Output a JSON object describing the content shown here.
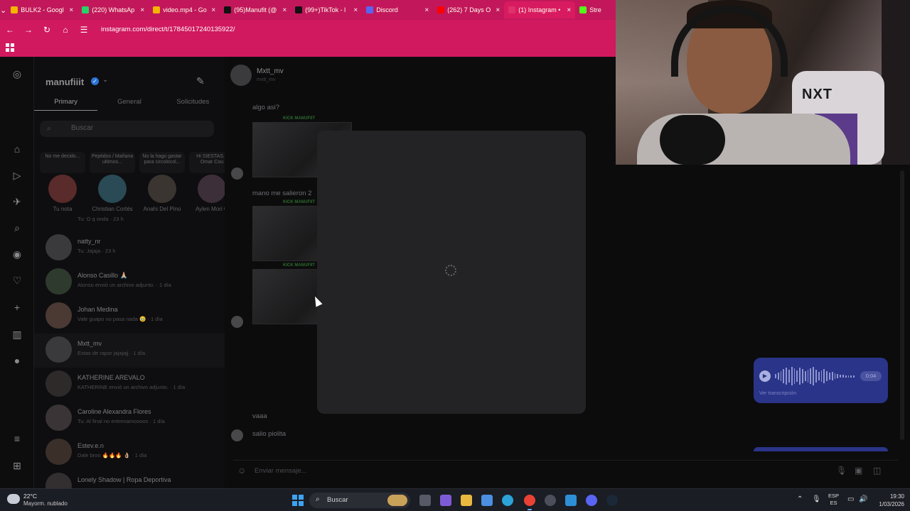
{
  "browser": {
    "tabs": [
      {
        "title": "BULK2 - Googl",
        "color": "#f4b400"
      },
      {
        "title": "(220) WhatsAp",
        "color": "#25d366"
      },
      {
        "title": "video.mp4 - Go",
        "color": "#f4b400"
      },
      {
        "title": "(95)Manufit (@",
        "color": "#111111"
      },
      {
        "title": "(99+)TikTok - l",
        "color": "#111111"
      },
      {
        "title": "Discord",
        "color": "#5865f2"
      },
      {
        "title": "(262) 7 Days O",
        "color": "#ff0000"
      },
      {
        "title": "(1) Instagram •",
        "color": "#e1306c",
        "active": true
      },
      {
        "title": "Stre",
        "color": "#53fc18"
      }
    ],
    "url": "instagram.com/direct/t/17845017240135922/"
  },
  "inbox": {
    "username": "manufiiit",
    "tabs": [
      "Primary",
      "General",
      "Solicitudes"
    ],
    "search_placeholder": "Buscar",
    "notes": [
      {
        "text": "No me decido...",
        "name": "Tu nota"
      },
      {
        "text": "Peptidos / Mañana ultimos...",
        "name": "Christian Cortés"
      },
      {
        "text": "No la hago gastar para circolocol...",
        "name": "Anahi Del Pino"
      },
      {
        "text": "Hi SIESTAS... Omar Cou",
        "name": "Aylen Mori G"
      }
    ],
    "conversations": [
      {
        "name": "",
        "preview": "Tu: O q onda · 23 h"
      },
      {
        "name": "natty_nr",
        "preview": "Tu: Jajaja · 23 h"
      },
      {
        "name": "Alonso Casillo 🙏🏼",
        "preview": "Alonso envió un archivo adjunto. · 1 día"
      },
      {
        "name": "Johan Medina",
        "preview": "Vale guapo no pasa nada 🥹 · 1 día"
      },
      {
        "name": "Mxtt_mv",
        "preview": "Estas de rapor jajajajj · 1 día",
        "selected": true
      },
      {
        "name": "KATHERINE AREVALO",
        "preview": "KATHERINE envió un archivo adjunto. · 1 día"
      },
      {
        "name": "Caroline Alexandra Flores",
        "preview": "Tu: Al final no entrenamoooos · 1 día"
      },
      {
        "name": "Estev.e.n",
        "preview": "Dale broo 🔥🔥🔥 👌🏼 · 1 día"
      },
      {
        "name": "Lonely Shadow | Ropa Deportiva",
        "preview": ""
      }
    ]
  },
  "chat": {
    "contact_name": "Mxtt_mv",
    "contact_handle": "mxtt_mv",
    "messages": [
      "algo asi?",
      "mano me salieron 2",
      "vaaa",
      "salio piolita"
    ],
    "thumb_label": "KICK MANUFIIT",
    "voice_duration": "0:04",
    "voice_transcript": "Ver transcripción",
    "composer_placeholder": "Enviar mensaje..."
  },
  "webcam": {
    "chair_brand": "NXT"
  },
  "taskbar": {
    "temp": "22°C",
    "weather": "Mayorm. nublado",
    "search": "Buscar",
    "lang1": "ESP",
    "lang2": "ES",
    "time": "19:30",
    "date": "1/03/2026"
  }
}
